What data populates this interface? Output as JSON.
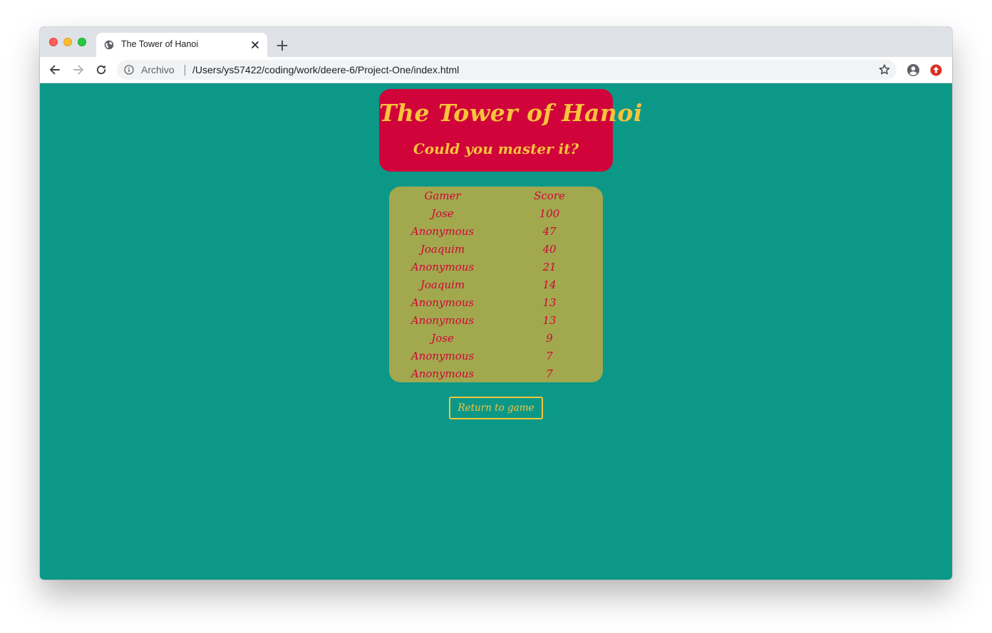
{
  "browser": {
    "tab": {
      "title": "The Tower of Hanoi"
    },
    "address_bar": {
      "security_label": "Archivo",
      "url": "/Users/ys57422/coding/work/deere-6/Project-One/index.html"
    }
  },
  "page": {
    "title": "The Tower of Hanoi",
    "subtitle": "Could you master it?",
    "scoreboard": {
      "headers": {
        "gamer": "Gamer",
        "score": "Score"
      },
      "rows": [
        {
          "gamer": "Jose",
          "score": "100"
        },
        {
          "gamer": "Anonymous",
          "score": "47"
        },
        {
          "gamer": "Joaquim",
          "score": "40"
        },
        {
          "gamer": "Anonymous",
          "score": "21"
        },
        {
          "gamer": "Joaquim",
          "score": "14"
        },
        {
          "gamer": "Anonymous",
          "score": "13"
        },
        {
          "gamer": "Anonymous",
          "score": "13"
        },
        {
          "gamer": "Jose",
          "score": "9"
        },
        {
          "gamer": "Anonymous",
          "score": "7"
        },
        {
          "gamer": "Anonymous",
          "score": "7"
        }
      ]
    },
    "return_button_label": "Return to game"
  },
  "colors": {
    "page_background": "#0c9887",
    "header_background": "#d0043a",
    "header_text": "#f7c43b",
    "scoreboard_background": "#a2a84e",
    "scoreboard_text": "#d0043a",
    "button_border": "#f7c43b"
  },
  "icons": {
    "tab_favicon": "globe-icon",
    "tab_close": "close-icon",
    "new_tab": "plus-icon",
    "back": "arrow-left-icon",
    "forward": "arrow-right-icon",
    "reload": "reload-icon",
    "site_info": "info-icon",
    "bookmark": "star-icon",
    "profile": "account-circle-icon",
    "extension": "update-icon"
  }
}
